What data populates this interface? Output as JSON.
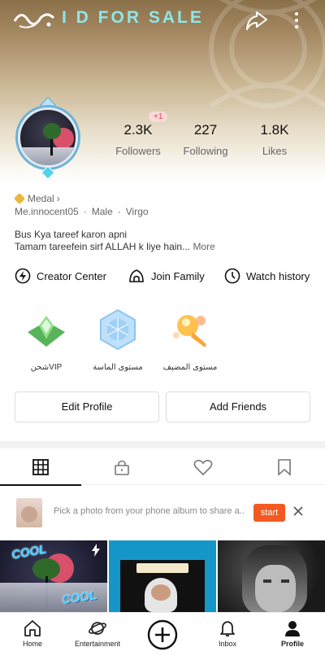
{
  "header": {
    "store_title": "I D FOR SALE",
    "share_label": "share-icon",
    "more_label": "more-icon"
  },
  "profile": {
    "stats": [
      {
        "value": "2.3K",
        "label": "Followers"
      },
      {
        "value": "227",
        "label": "Following"
      },
      {
        "value": "1.8K",
        "label": "Likes"
      }
    ],
    "followers_new_badge": "+1",
    "medal_label": "Medal",
    "username": "Me.innocent05",
    "gender": "Male",
    "zodiac": "Virgo",
    "bio_line1": "Bus Kya tareef karon apni",
    "bio_line2": "Tamam tareefein sirf ALLAH k liye hain...",
    "bio_more": "More"
  },
  "actions": [
    {
      "label": "Creator Center",
      "icon": "lightning-icon"
    },
    {
      "label": "Join Family",
      "icon": "family-icon"
    },
    {
      "label": "Watch history",
      "icon": "clock-icon"
    }
  ],
  "badges": [
    {
      "label": "شحنVIP",
      "icon": "vip-badge-icon"
    },
    {
      "label": "مستوى الماسة",
      "icon": "diamond-level-icon"
    },
    {
      "label": "مستوى المضيف",
      "icon": "host-level-icon"
    }
  ],
  "buttons": {
    "edit_profile": "Edit Profile",
    "add_friends": "Add Friends"
  },
  "suggestion": {
    "text": "Pick a photo from your phone album to share a...",
    "start": "start"
  },
  "grid_overlays": {
    "cool_top": "COOL",
    "cool_bottom": "COOL"
  },
  "navbar": [
    {
      "label": "Home",
      "icon": "home-icon"
    },
    {
      "label": "Entertainment",
      "icon": "planet-icon"
    },
    {
      "label": "",
      "icon": "plus-icon"
    },
    {
      "label": "Inbox",
      "icon": "bell-icon"
    },
    {
      "label": "Profile",
      "icon": "profile-icon"
    }
  ],
  "colors": {
    "accent": "#f25a22",
    "title": "#8fe6ea"
  }
}
